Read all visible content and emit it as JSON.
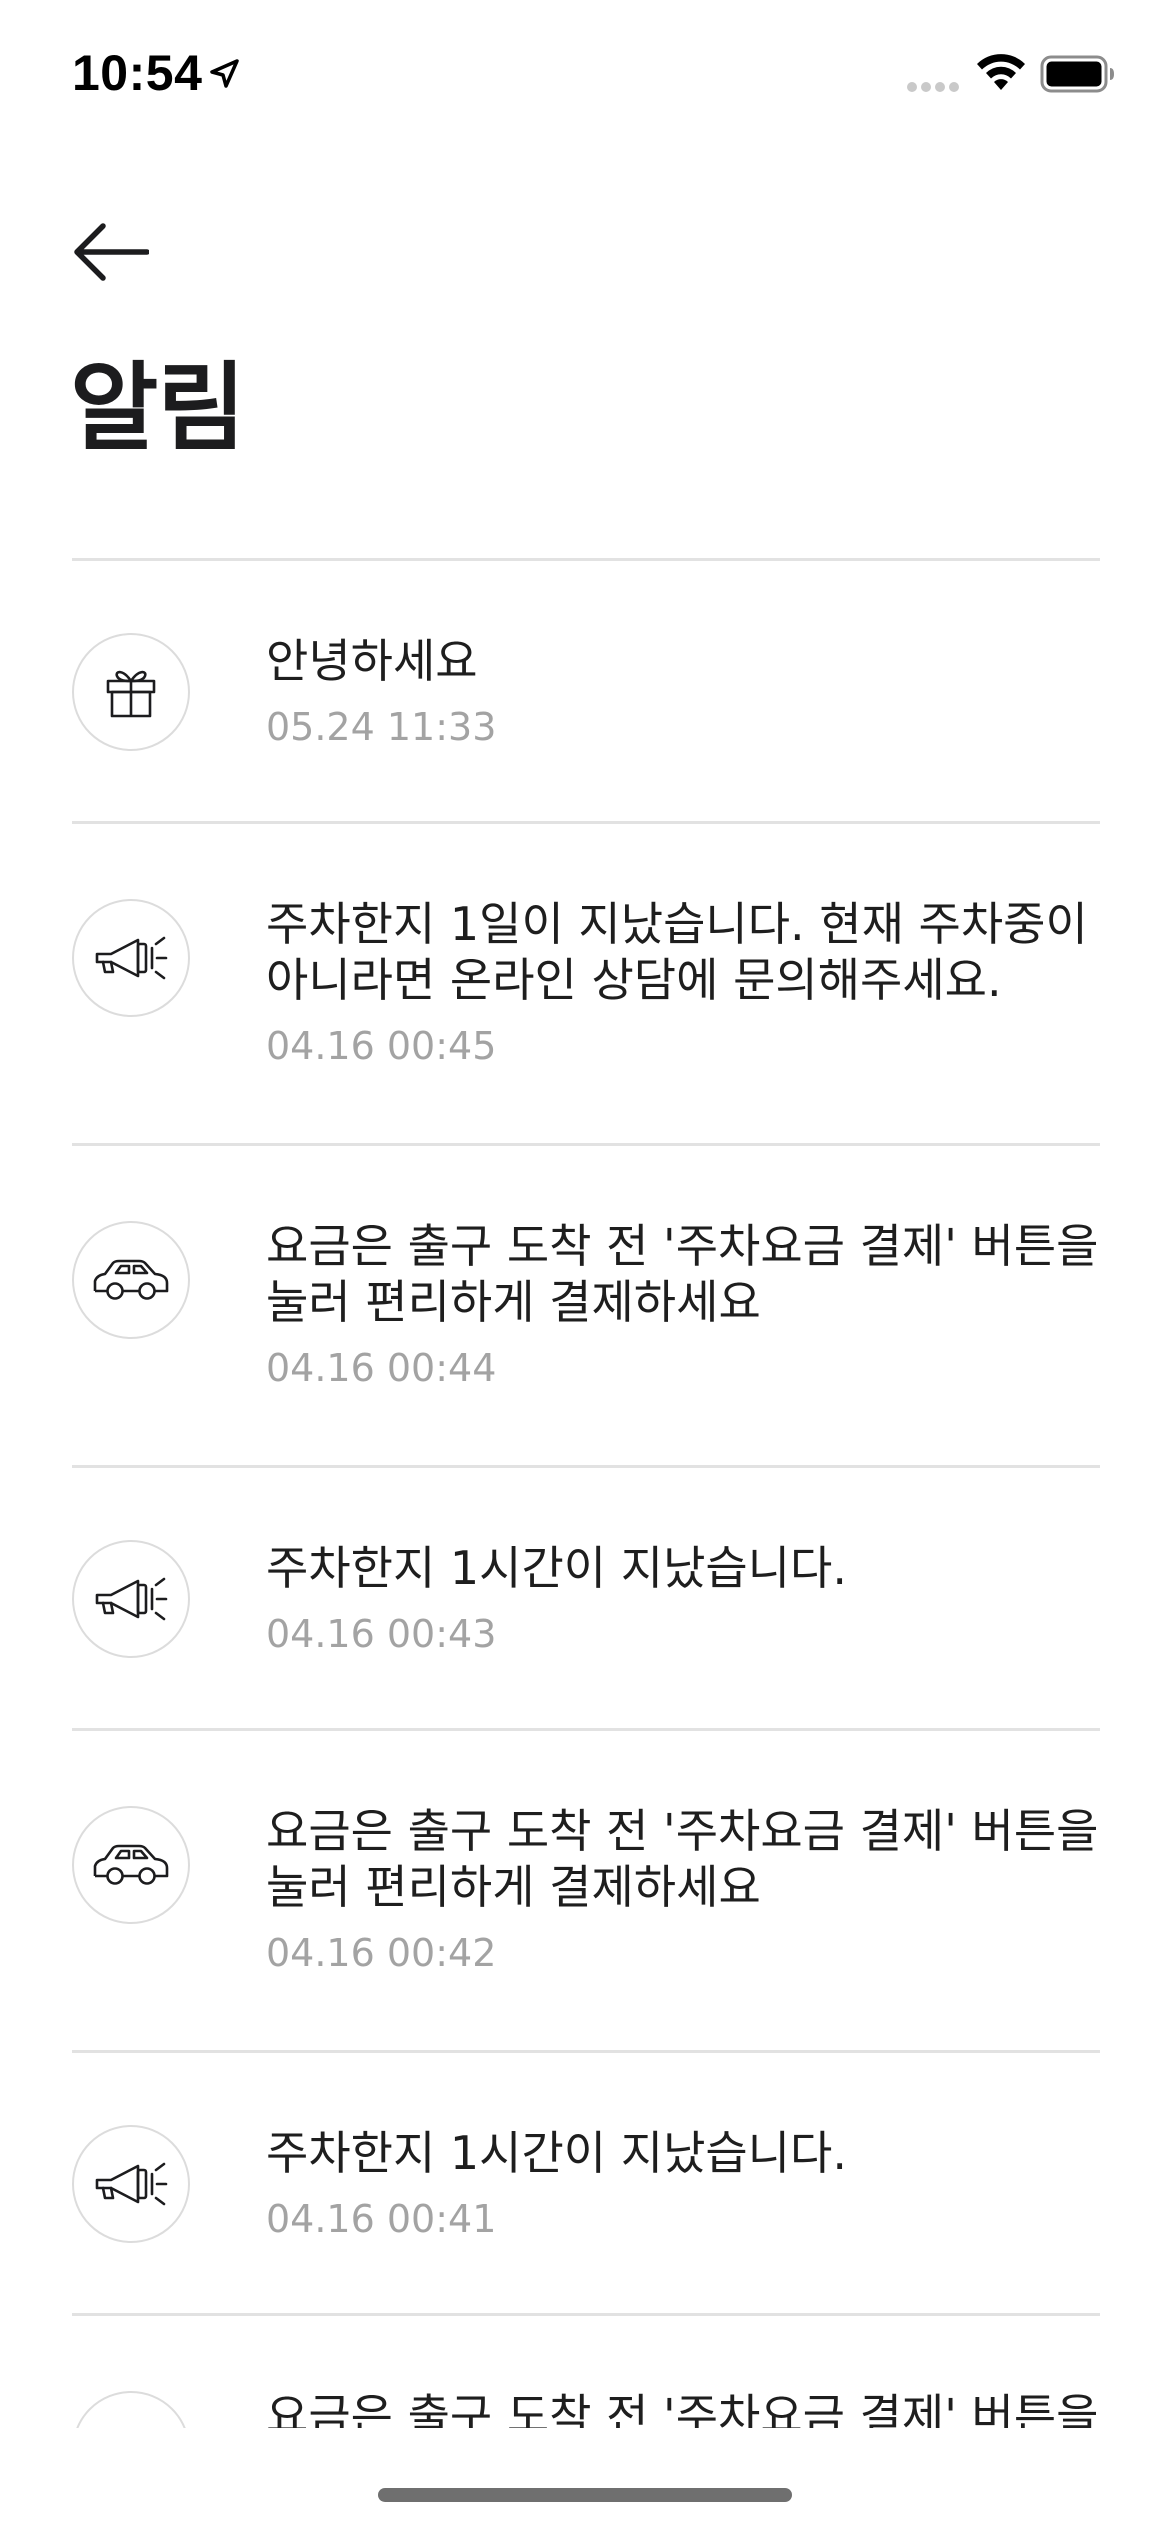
{
  "status_bar": {
    "time": "10:54"
  },
  "header": {
    "title": "알림"
  },
  "notifications": [
    {
      "icon": "gift-icon",
      "title": "안녕하세요",
      "date": "05.24 11:33"
    },
    {
      "icon": "megaphone-icon",
      "title": "주차한지 1일이 지났습니다. 현재 주차중이 아니라면 온라인 상담에 문의해주세요.",
      "date": "04.16 00:45"
    },
    {
      "icon": "car-icon",
      "title": "요금은 출구 도착 전 '주차요금 결제' 버튼을 눌러 편리하게 결제하세요",
      "date": "04.16 00:44"
    },
    {
      "icon": "megaphone-icon",
      "title": "주차한지 1시간이 지났습니다.",
      "date": "04.16 00:43"
    },
    {
      "icon": "car-icon",
      "title": "요금은 출구 도착 전 '주차요금 결제' 버튼을 눌러 편리하게 결제하세요",
      "date": "04.16 00:42"
    },
    {
      "icon": "megaphone-icon",
      "title": "주차한지 1시간이 지났습니다.",
      "date": "04.16 00:41"
    },
    {
      "icon": "car-icon",
      "title": "요금은 출구 도착 전 '주차요금 결제' 버튼을 눌러 편리하게 결제하세요",
      "date": ""
    }
  ]
}
